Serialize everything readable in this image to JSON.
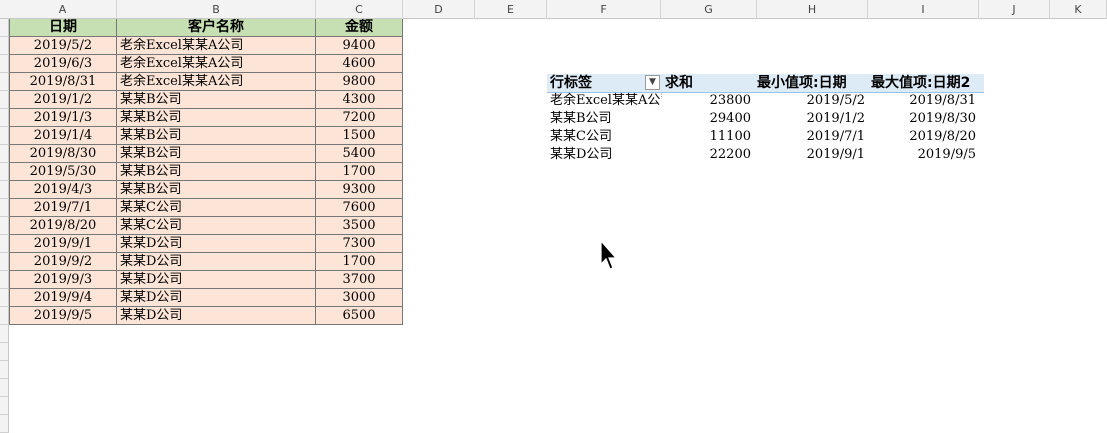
{
  "columns": [
    "A",
    "B",
    "C",
    "D",
    "E",
    "F",
    "G",
    "H",
    "I",
    "J",
    "K"
  ],
  "sheet_table": {
    "headers": [
      "日期",
      "客户名称",
      "金额"
    ],
    "rows": [
      [
        "2019/5/2",
        "老余Excel某某A公司",
        "9400"
      ],
      [
        "2019/6/3",
        "老余Excel某某A公司",
        "4600"
      ],
      [
        "2019/8/31",
        "老余Excel某某A公司",
        "9800"
      ],
      [
        "2019/1/2",
        "某某B公司",
        "4300"
      ],
      [
        "2019/1/3",
        "某某B公司",
        "7200"
      ],
      [
        "2019/1/4",
        "某某B公司",
        "1500"
      ],
      [
        "2019/8/30",
        "某某B公司",
        "5400"
      ],
      [
        "2019/5/30",
        "某某B公司",
        "1700"
      ],
      [
        "2019/4/3",
        "某某B公司",
        "9300"
      ],
      [
        "2019/7/1",
        "某某C公司",
        "7600"
      ],
      [
        "2019/8/20",
        "某某C公司",
        "3500"
      ],
      [
        "2019/9/1",
        "某某D公司",
        "7300"
      ],
      [
        "2019/9/2",
        "某某D公司",
        "1700"
      ],
      [
        "2019/9/3",
        "某某D公司",
        "3700"
      ],
      [
        "2019/9/4",
        "某某D公司",
        "3000"
      ],
      [
        "2019/9/5",
        "某某D公司",
        "6500"
      ]
    ]
  },
  "pivot": {
    "row_label_header": "行标签",
    "sum_header": "求和",
    "min_header": "最小值项:日期",
    "max_header": "最大值项:日期2",
    "filter_icon": "dropdown-arrow-icon",
    "rows": [
      [
        "老余Excel某某A公司",
        "23800",
        "2019/5/2",
        "2019/8/31"
      ],
      [
        "某某B公司",
        "29400",
        "2019/1/2",
        "2019/8/30"
      ],
      [
        "某某C公司",
        "11100",
        "2019/7/1",
        "2019/8/20"
      ],
      [
        "某某D公司",
        "22200",
        "2019/9/1",
        "2019/9/5"
      ]
    ]
  },
  "colors": {
    "table_header_bg": "#c6e0b4",
    "table_data_bg": "#fce4d6",
    "pivot_header_bg": "#ddebf7"
  }
}
